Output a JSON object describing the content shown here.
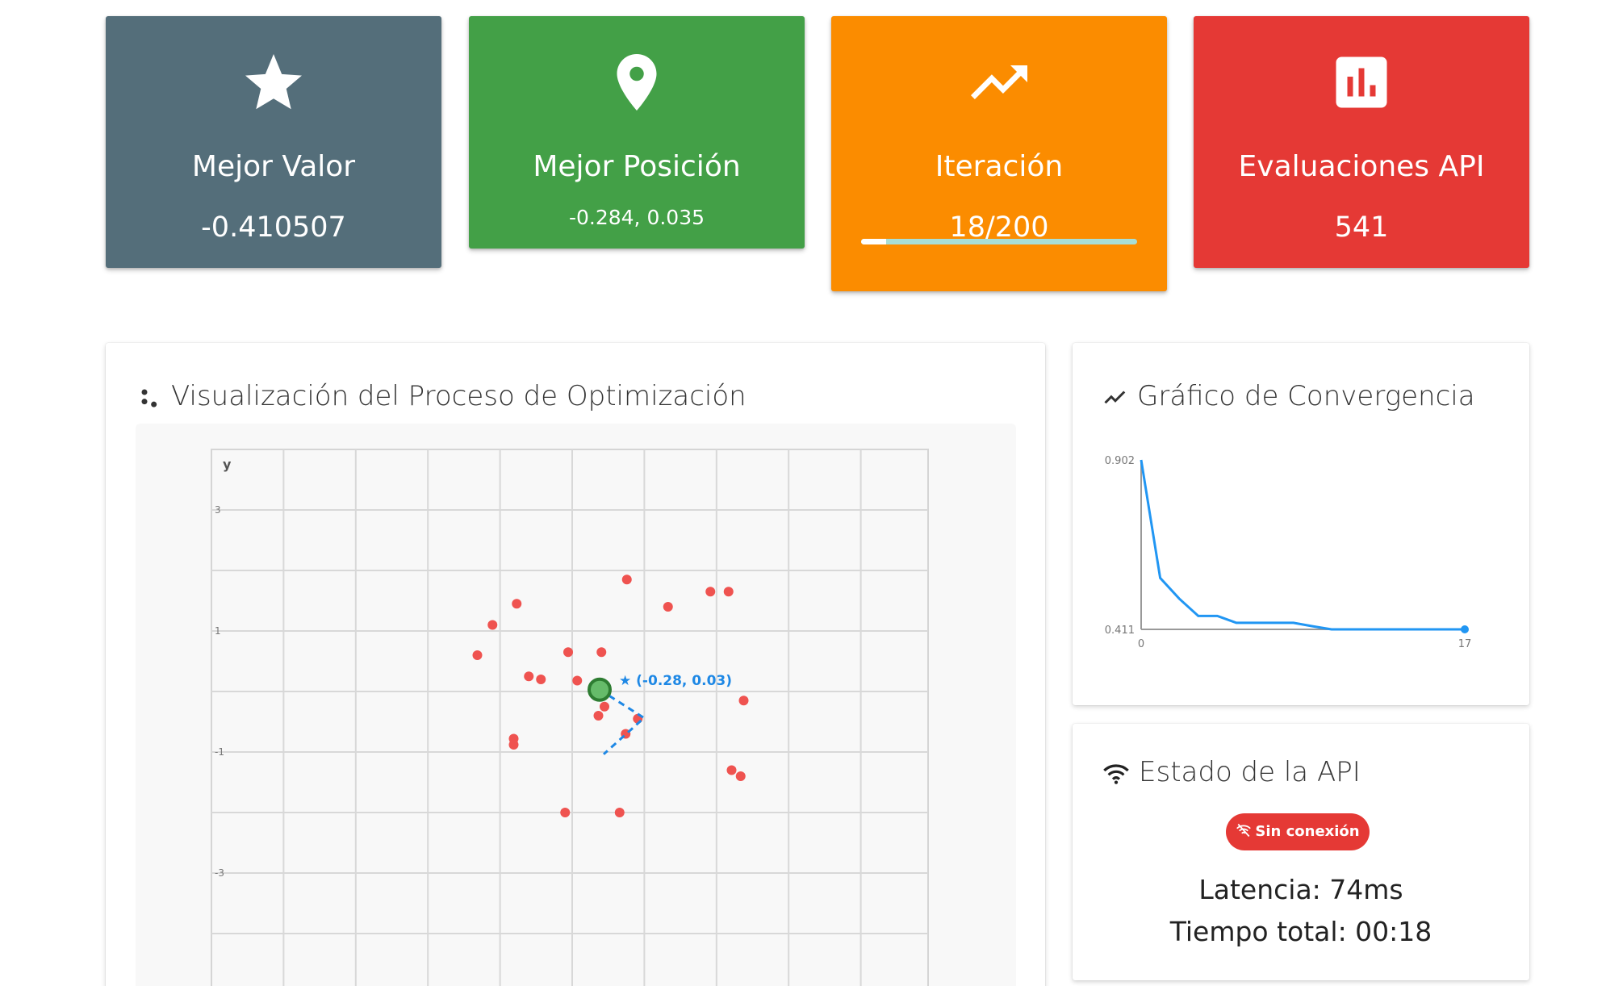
{
  "stats": {
    "best_value": {
      "icon": "star-icon",
      "title": "Mejor Valor",
      "value": "-0.410507"
    },
    "best_position": {
      "icon": "location-pin-icon",
      "title": "Mejor Posición",
      "value": "-0.284, 0.035"
    },
    "iteration": {
      "icon": "trending-up-icon",
      "title": "Iteración",
      "value": "18/200",
      "progress": 0.09
    },
    "api_evaluations": {
      "icon": "bar-chart-icon",
      "title": "Evaluaciones API",
      "value": "541"
    }
  },
  "viz_panel": {
    "title": "Visualización del Proceso de Optimización",
    "icon": "scatter-dots-icon",
    "chart_data": {
      "type": "scatter",
      "ylabel": "y",
      "y_ticks": [
        "3",
        "1",
        "-1",
        "-3"
      ],
      "best_point": {
        "x": -0.28,
        "y": 0.03,
        "label": "★ (-0.28, 0.03)"
      },
      "points": [
        [
          0.17,
          1.85
        ],
        [
          -1.65,
          1.45
        ],
        [
          0.85,
          1.4
        ],
        [
          1.55,
          1.65
        ],
        [
          1.85,
          1.65
        ],
        [
          -2.05,
          1.1
        ],
        [
          -2.3,
          0.6
        ],
        [
          -0.8,
          0.65
        ],
        [
          -0.25,
          0.65
        ],
        [
          -1.45,
          0.25
        ],
        [
          -1.25,
          0.2
        ],
        [
          -0.65,
          0.18
        ],
        [
          -0.35,
          0.0
        ],
        [
          -0.2,
          -0.25
        ],
        [
          -0.3,
          -0.4
        ],
        [
          0.35,
          -0.45
        ],
        [
          0.15,
          -0.7
        ],
        [
          2.1,
          -0.15
        ],
        [
          -1.7,
          -0.78
        ],
        [
          -1.7,
          -0.88
        ],
        [
          1.9,
          -1.3
        ],
        [
          2.05,
          -1.4
        ],
        [
          -0.85,
          -2.0
        ],
        [
          0.05,
          -2.0
        ]
      ]
    }
  },
  "convergence_panel": {
    "title": "Gráfico de Convergencia",
    "icon": "trend-line-icon",
    "chart_data": {
      "type": "line",
      "y_ticks": [
        "0.902",
        "0.411"
      ],
      "x_ticks": [
        "0",
        "17"
      ],
      "x": [
        0,
        1,
        2,
        3,
        4,
        5,
        6,
        7,
        8,
        9,
        10,
        11,
        12,
        13,
        14,
        15,
        16,
        17
      ],
      "values": [
        0.902,
        0.56,
        0.5,
        0.45,
        0.45,
        0.43,
        0.43,
        0.43,
        0.43,
        0.42,
        0.411,
        0.411,
        0.411,
        0.411,
        0.411,
        0.411,
        0.411,
        0.411
      ],
      "colors": {
        "line": "#2196f3",
        "axis": "#999999"
      }
    }
  },
  "api_panel": {
    "title": "Estado de la API",
    "icon": "wifi-icon",
    "status_badge": {
      "icon": "wifi-off-icon",
      "text": "Sin conexión",
      "color": "#e53935"
    },
    "latency": "Latencia: 74ms",
    "total_time": "Tiempo total: 00:18"
  },
  "colors": {
    "card_grey": "#546e7a",
    "card_green": "#43a047",
    "card_orange": "#fb8c00",
    "card_red": "#e53935",
    "point_red": "#ef5350",
    "best_green": "#43a047",
    "accent_blue": "#1e88e5"
  }
}
